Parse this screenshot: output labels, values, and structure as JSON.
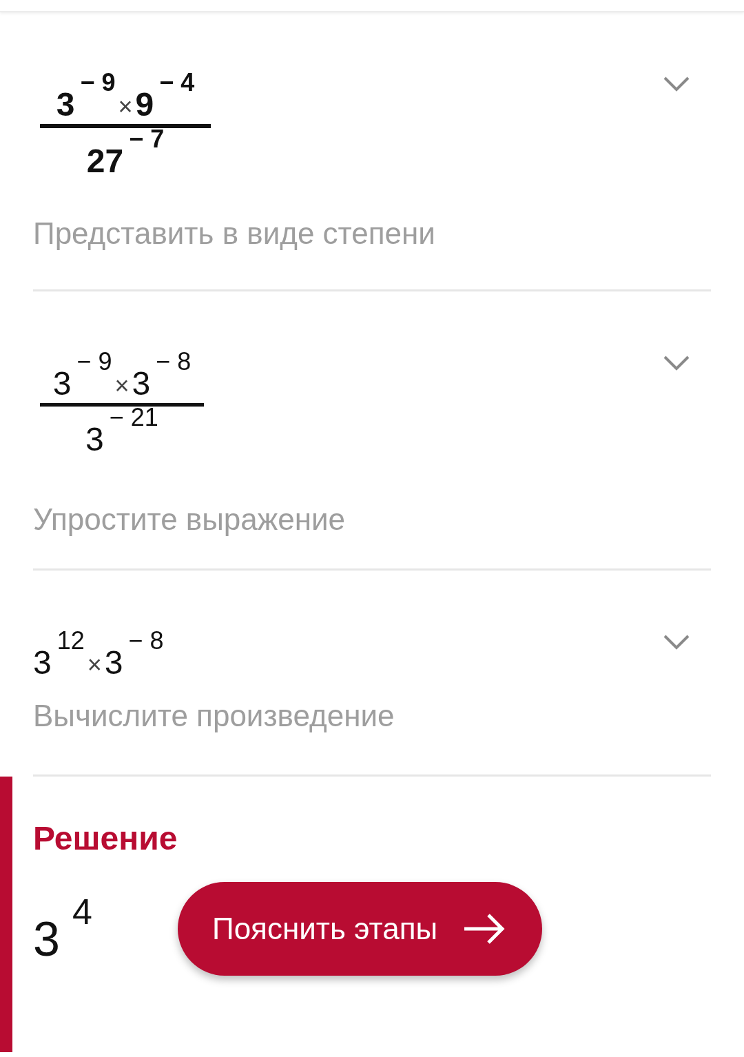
{
  "steps": [
    {
      "kind": "fraction",
      "emphasized": true,
      "expanded": false,
      "numerator": [
        {
          "base": "3",
          "exponent": "− 9"
        },
        {
          "op": "×"
        },
        {
          "base": "9",
          "exponent": "− 4"
        }
      ],
      "denominator": [
        {
          "base": "27",
          "exponent": "− 7"
        }
      ],
      "description": "Представить в виде степени"
    },
    {
      "kind": "fraction",
      "emphasized": false,
      "expanded": false,
      "numerator": [
        {
          "base": "3",
          "exponent": "− 9"
        },
        {
          "op": "×"
        },
        {
          "base": "3",
          "exponent": "− 8"
        }
      ],
      "denominator": [
        {
          "base": "3",
          "exponent": "− 21"
        }
      ],
      "description": "Упростите выражение"
    },
    {
      "kind": "product",
      "emphasized": false,
      "expanded": false,
      "terms": [
        {
          "base": "3",
          "exponent": "12"
        },
        {
          "op": "×"
        },
        {
          "base": "3",
          "exponent": "− 8"
        }
      ],
      "description": "Вычислите произведение"
    }
  ],
  "solution": {
    "title": "Решение",
    "result": {
      "base": "3",
      "exponent": "4"
    },
    "button": "Пояснить этапы"
  }
}
